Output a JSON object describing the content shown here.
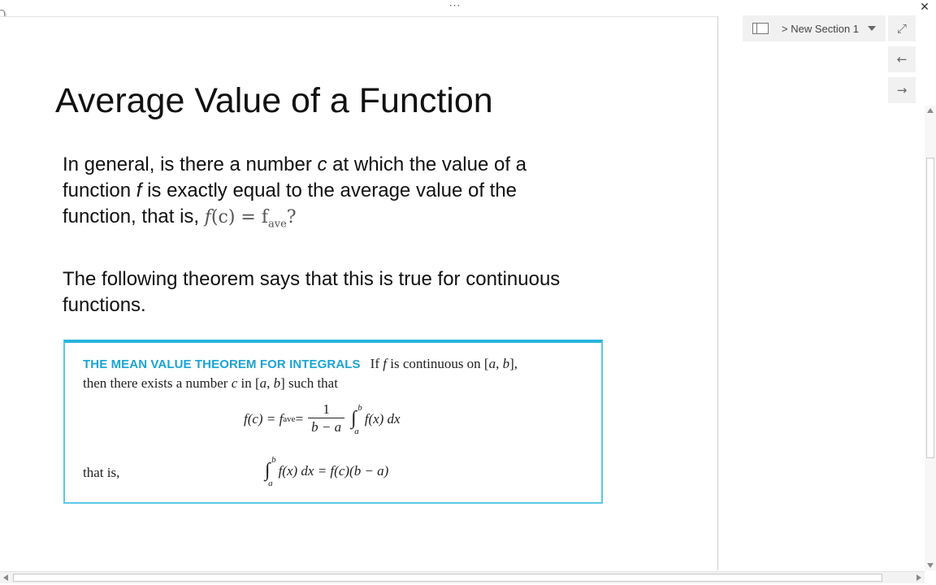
{
  "window": {
    "more_label": "···",
    "close_label": "✕"
  },
  "slide": {
    "title": "Average Value of a Function",
    "para1": {
      "line1_before": "In general, is there a number ",
      "line1_var": "c",
      "line1_after": " at which the value of a",
      "line2_before": "function ",
      "line2_var": "f",
      "line2_after": " is exactly equal to the average value of the",
      "line3_text": "function, that is, ",
      "line3_math_lhs": "f",
      "line3_math_mid": "(c) = f",
      "line3_math_sub": "ave",
      "line3_math_end": "?"
    },
    "para2": {
      "line1": "The following theorem says that this is true for continuous",
      "line2": "functions."
    }
  },
  "theorem": {
    "heading": "THE MEAN VALUE THEOREM FOR INTEGRALS",
    "line1_a": "If ",
    "line1_f": "f",
    "line1_b": " is continuous on [",
    "line1_a_var": "a",
    "line1_comma": ", ",
    "line1_b_var": "b",
    "line1_end": "],",
    "line2_a": "then there exists a number ",
    "line2_c": "c",
    "line2_b": " in [",
    "line2_avar": "a",
    "line2_comma": ", ",
    "line2_bvar": "b",
    "line2_end": "] such that",
    "eq1_lhs": "f(c) = f",
    "eq1_sub": "ave",
    "eq1_eq": " = ",
    "eq1_num": "1",
    "eq1_den": "b − a",
    "eq1_integrand": "f(x) dx",
    "lim_upper": "b",
    "lim_lower": "a",
    "integral_sign": "∫",
    "that_is": "that is,",
    "eq2_integrand": "f(x) dx = f(c)(b − a)"
  },
  "panel": {
    "section_label": "> New Section 1",
    "expand_label": "⤢",
    "back_label": "←",
    "forward_label": "→"
  }
}
